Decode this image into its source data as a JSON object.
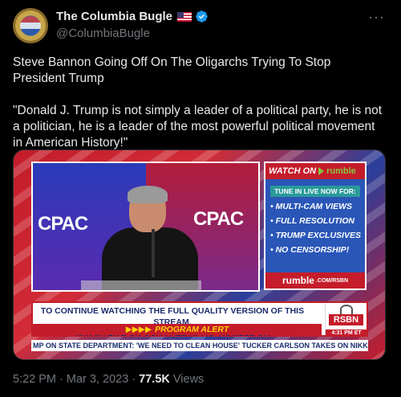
{
  "account": {
    "name": "The Columbia Bugle",
    "handle": "@ColumbiaBugle",
    "flag_icon": "us-flag-icon",
    "verified_color": "#1d9bf0"
  },
  "tweet": {
    "text_line1": "Steve Bannon Going Off On The Oligarchs Trying To Stop President Trump",
    "text_line2": "\"Donald J. Trump is not simply a leader of a political party, he is not a politician, he is a leader of the most powerful political movement in American History!\""
  },
  "media": {
    "cpac_left": "CPAC",
    "cpac_right": "CPAC",
    "promo": {
      "watch_on": "WATCH ON",
      "rumble": "rumble",
      "tune_in": "TUNE IN LIVE NOW FOR:",
      "items": [
        "• MULTI-CAM VIEWS",
        "• FULL RESOLUTION",
        "• TRUMP EXCLUSIVES",
        "• NO CENSORSHIP!"
      ],
      "footer_main": "rumble",
      "footer_sub": ".COM/RSBN"
    },
    "banner": {
      "line1": "TO CONTINUE WATCHING THE FULL QUALITY VERSION OF THIS STREAM,",
      "line2": "WATCH LIVE ON OUR FREE APP, ▶ RUMBLE OR RSBNETWORK.COM.",
      "alert": "PROGRAM ALERT",
      "alert_prefix": "▶▶▶▶"
    },
    "rsbn": {
      "logo": "RSBN",
      "time": "4:31 PM ET"
    },
    "ticker": "MP ON STATE DEPARTMENT: 'WE NEED TO CLEAN HOUSE'    TUCKER CARLSON TAKES ON NIKKI HALEY, SA"
  },
  "meta": {
    "time": "5:22 PM · Mar 3, 2023 · ",
    "views_count": "77.5K",
    "views_label": " Views"
  }
}
